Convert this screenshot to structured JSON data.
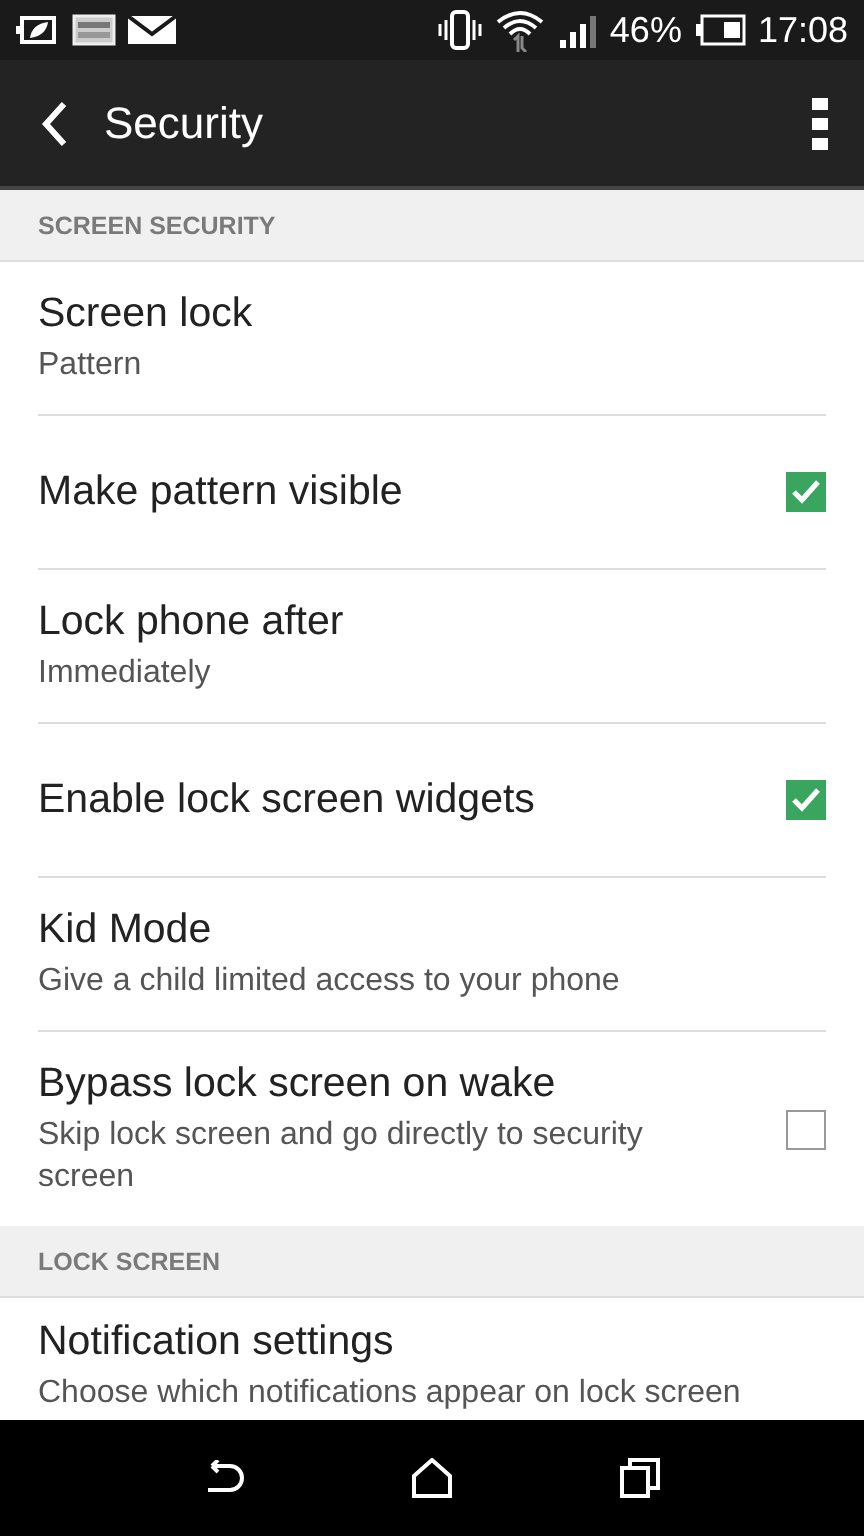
{
  "status_bar": {
    "battery": "46%",
    "time": "17:08"
  },
  "action_bar": {
    "title": "Security"
  },
  "items": [
    {
      "kind": "section",
      "title": "SCREEN SECURITY"
    },
    {
      "kind": "setting",
      "title": "Screen lock",
      "subtitle": "Pattern"
    },
    {
      "kind": "checkbox",
      "title": "Make pattern visible",
      "checked": true
    },
    {
      "kind": "setting",
      "title": "Lock phone after",
      "subtitle": "Immediately"
    },
    {
      "kind": "checkbox",
      "title": "Enable lock screen widgets",
      "checked": true
    },
    {
      "kind": "setting",
      "title": "Kid Mode",
      "subtitle": "Give a child limited access to your phone"
    },
    {
      "kind": "checkbox",
      "title": "Bypass lock screen on wake",
      "subtitle": "Skip lock screen and go directly to security screen",
      "checked": false
    },
    {
      "kind": "section",
      "title": "LOCK SCREEN"
    },
    {
      "kind": "setting",
      "title": "Notification settings",
      "subtitle": "Choose which notifications appear on lock screen"
    }
  ]
}
